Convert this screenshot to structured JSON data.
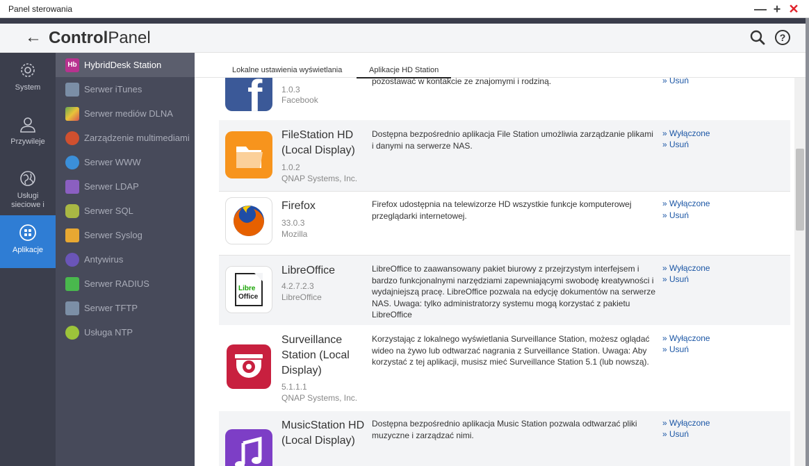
{
  "window": {
    "title": "Panel sterowania"
  },
  "header": {
    "brand_bold": "Control",
    "brand_light": "Panel"
  },
  "rail": [
    {
      "label": "System",
      "icon": "gear-icon"
    },
    {
      "label": "Przywileje",
      "icon": "user-icon"
    },
    {
      "label": "Usługi sieciowe i",
      "icon": "globe-icon"
    },
    {
      "label": "Aplikacje",
      "icon": "apps-grid-icon",
      "active": true
    }
  ],
  "submenu": [
    {
      "label": "HybridDesk Station",
      "icon": "hybriddesk-icon",
      "color": "#b8328f",
      "active": true
    },
    {
      "label": "Serwer iTunes",
      "icon": "itunes-icon",
      "color": "#7b8ea6"
    },
    {
      "label": "Serwer mediów DLNA",
      "icon": "dlna-icon",
      "color": "#6aa84f"
    },
    {
      "label": "Zarządzenie multimediami",
      "icon": "film-reel-icon",
      "color": "#d0502f"
    },
    {
      "label": "Serwer WWW",
      "icon": "www-globe-icon",
      "color": "#3b8fd9"
    },
    {
      "label": "Serwer LDAP",
      "icon": "ldap-icon",
      "color": "#8b5fc1"
    },
    {
      "label": "Serwer SQL",
      "icon": "database-icon",
      "color": "#a9b844"
    },
    {
      "label": "Serwer Syslog",
      "icon": "envelope-icon",
      "color": "#e8a832"
    },
    {
      "label": "Antywirus",
      "icon": "antivirus-icon",
      "color": "#6a55b8"
    },
    {
      "label": "Serwer RADIUS",
      "icon": "wifi-icon",
      "color": "#49b84d"
    },
    {
      "label": "Serwer TFTP",
      "icon": "tftp-icon",
      "color": "#7c8fa6"
    },
    {
      "label": "Usługa NTP",
      "icon": "clock-icon",
      "color": "#9cc43a"
    }
  ],
  "tabs": [
    {
      "label": "Lokalne ustawienia wyświetlania"
    },
    {
      "label": "Aplikacje HD Station",
      "active": true
    }
  ],
  "apps": [
    {
      "name": "",
      "version": "1.0.3",
      "vendor": "Facebook",
      "description": "pozostawać w kontakcie ze znajomymi i rodziną.",
      "actions": [
        "» Usuń"
      ],
      "icon": "facebook-icon",
      "color": "#3b5998"
    },
    {
      "name": "FileStation HD (Local Display)",
      "version": "1.0.2",
      "vendor": "QNAP Systems, Inc.",
      "description": "Dostępna bezpośrednio aplikacja File Station umożliwia zarządzanie plikami i danymi na serwerze NAS.",
      "actions": [
        "» Wyłączone",
        "» Usuń"
      ],
      "icon": "folder-icon",
      "color": "#f7941d"
    },
    {
      "name": "Firefox",
      "version": "33.0.3",
      "vendor": "Mozilla",
      "description": "Firefox udostępnia na telewizorze HD wszystkie funkcje komputerowej przeglądarki internetowej.",
      "actions": [
        "» Wyłączone",
        "» Usuń"
      ],
      "icon": "firefox-icon",
      "color": "#e66000"
    },
    {
      "name": "LibreOffice",
      "version": "4.2.7.2.3",
      "vendor": "LibreOffice",
      "description": "LibreOffice to zaawansowany pakiet biurowy z przejrzystym interfejsem i bardzo funkcjonalnymi narzędziami zapewniającymi swobodę kreatywności i wydajniejszą pracę. LibreOffice pozwala na edycję dokumentów na serwerze NAS. Uwaga: tylko administratorzy systemu mogą korzystać z pakietu LibreOffice",
      "actions": [
        "» Wyłączone",
        "» Usuń"
      ],
      "icon": "libreoffice-icon",
      "icon_text_1": "Libre",
      "icon_text_2": "Office",
      "color": "#18a303"
    },
    {
      "name": "Surveillance Station (Local Display)",
      "version": "5.1.1.1",
      "vendor": "QNAP Systems, Inc.",
      "description": "Korzystając z lokalnego wyświetlania Surveillance Station, możesz oglądać wideo na żywo lub odtwarzać nagrania z Surveillance Station. Uwaga: Aby korzystać z tej aplikacji, musisz mieć Surveillance Station 5.1 (lub nowszą).",
      "actions": [
        "» Wyłączone",
        "» Usuń"
      ],
      "icon": "camera-icon",
      "color": "#c8203f"
    },
    {
      "name": "MusicStation HD (Local Display)",
      "version": "",
      "vendor": "",
      "description": "Dostępna bezpośrednio aplikacja Music Station pozwala odtwarzać pliki muzyczne i zarządzać nimi.",
      "actions": [
        "» Wyłączone",
        "» Usuń"
      ],
      "icon": "music-note-icon",
      "color": "#7d3ec6"
    }
  ]
}
